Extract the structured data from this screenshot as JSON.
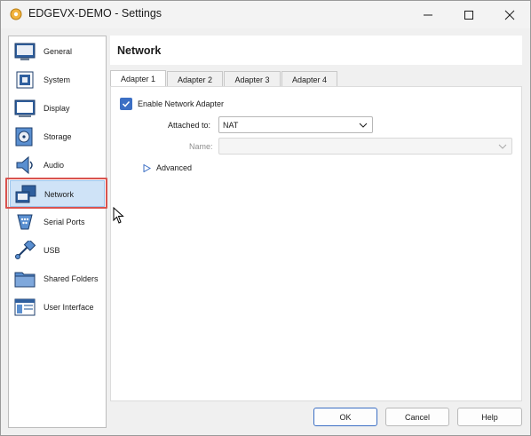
{
  "window": {
    "title": "EDGEVX-DEMO - Settings"
  },
  "sidebar": {
    "items": [
      {
        "label": "General",
        "icon": "general-icon"
      },
      {
        "label": "System",
        "icon": "system-icon"
      },
      {
        "label": "Display",
        "icon": "display-icon"
      },
      {
        "label": "Storage",
        "icon": "storage-icon"
      },
      {
        "label": "Audio",
        "icon": "audio-icon"
      },
      {
        "label": "Network",
        "icon": "network-icon",
        "selected": true
      },
      {
        "label": "Serial Ports",
        "icon": "serial-ports-icon"
      },
      {
        "label": "USB",
        "icon": "usb-icon"
      },
      {
        "label": "Shared Folders",
        "icon": "shared-folders-icon"
      },
      {
        "label": "User Interface",
        "icon": "user-interface-icon"
      }
    ]
  },
  "panel": {
    "title": "Network",
    "tabs": [
      {
        "label": "Adapter 1",
        "active": true
      },
      {
        "label": "Adapter 2"
      },
      {
        "label": "Adapter 3"
      },
      {
        "label": "Adapter 4"
      }
    ],
    "enable_adapter": {
      "label": "Enable Network Adapter",
      "checked": true
    },
    "attached_to": {
      "label": "Attached to:",
      "value": "NAT"
    },
    "name": {
      "label": "Name:",
      "value": ""
    },
    "advanced": {
      "label": "Advanced"
    }
  },
  "buttons": {
    "ok": "OK",
    "cancel": "Cancel",
    "help": "Help"
  },
  "colors": {
    "accent": "#3c6fc4",
    "selected_bg": "#cfe3f7",
    "highlight": "#d9534f"
  }
}
